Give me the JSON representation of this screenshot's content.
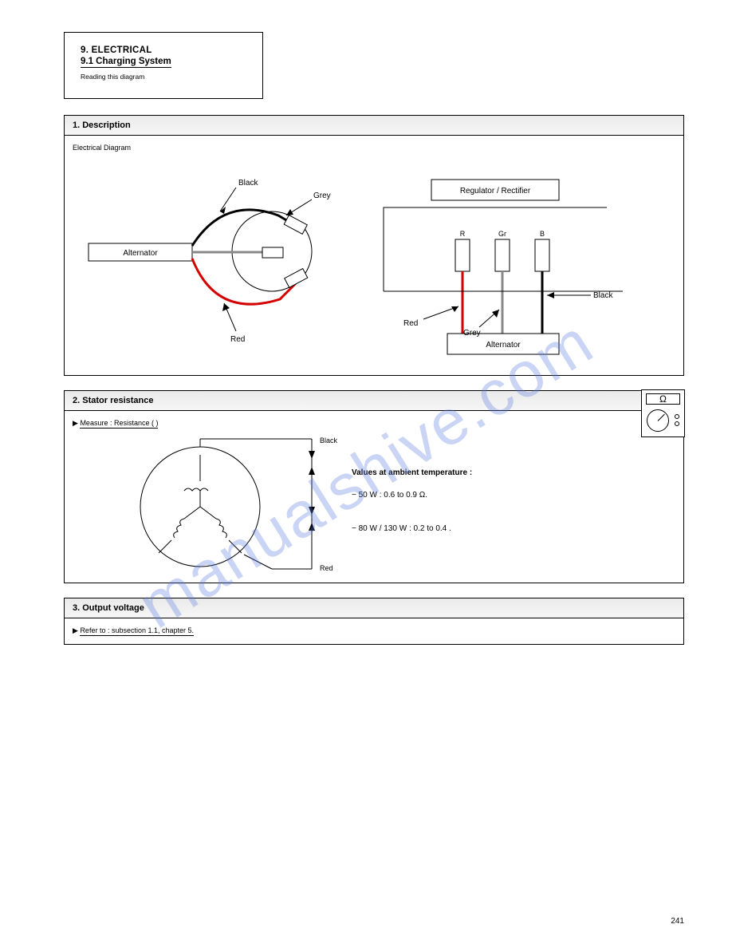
{
  "title": {
    "main": "9. ELECTRICAL",
    "sub": "9.1 Charging System",
    "note": "Reading this diagram"
  },
  "panel1": {
    "header": "1. Description",
    "sub": "Electrical Diagram",
    "left": {
      "alternator": "Alternator",
      "black": "Black",
      "grey": "Grey",
      "red": "Red"
    },
    "right": {
      "rectifier": "Regulator / Rectifier",
      "r": "R",
      "gr": "Gr",
      "b": "B",
      "red": "Red",
      "grey": "Grey",
      "black": "Black",
      "alt_label": "Alternator"
    }
  },
  "panel2": {
    "header": "2. Stator resistance",
    "measure_text": "Measure : Resistance (  )",
    "ambient": "Values at ambient temperature :",
    "line1a": "− 50 W : 0.6 to 0.9 ",
    "line1b": ".",
    "line2": "− 80 W / 130 W : 0.2 to 0.4   .",
    "black": "Black",
    "red": "Red"
  },
  "panel3": {
    "header": "3. Output voltage",
    "ref": "Refer to : subsection 1.1, chapter 5."
  },
  "watermark": "manualshive.com",
  "footer": "241"
}
